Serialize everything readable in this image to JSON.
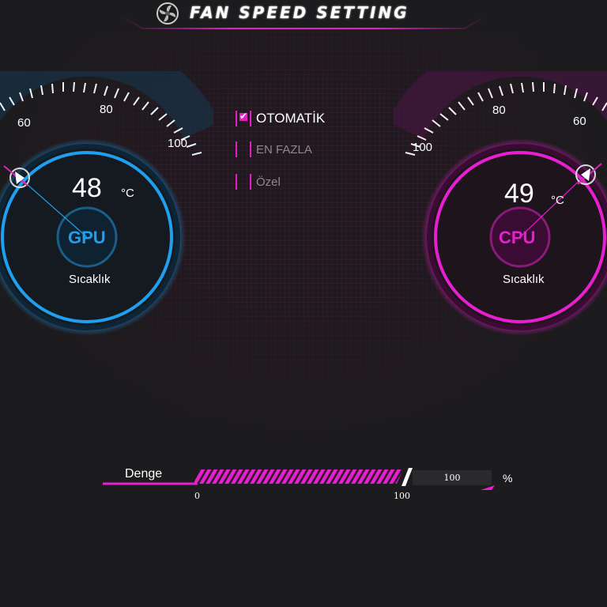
{
  "header": {
    "title": "FAN SPEED SETTING",
    "icon": "fan-icon"
  },
  "gpu": {
    "label": "GPU",
    "temperature": "48",
    "unit": "°C",
    "caption": "Sıcaklık",
    "scale_labels": [
      "60",
      "80",
      "100"
    ],
    "accent": "#1f9ff0"
  },
  "cpu": {
    "label": "CPU",
    "temperature": "49",
    "unit": "°C",
    "caption": "Sıcaklık",
    "scale_labels": [
      "100",
      "80",
      "60"
    ],
    "accent": "#e81fd0"
  },
  "modes": [
    {
      "label": "OTOMATİK",
      "selected": true
    },
    {
      "label": "EN FAZLA",
      "selected": false
    },
    {
      "label": "Özel",
      "selected": false
    }
  ],
  "fan_slider": {
    "label": "Denge",
    "min_label": "0",
    "max_label": "100",
    "value": "100",
    "unit": "%",
    "fill_fraction": 1.0
  }
}
